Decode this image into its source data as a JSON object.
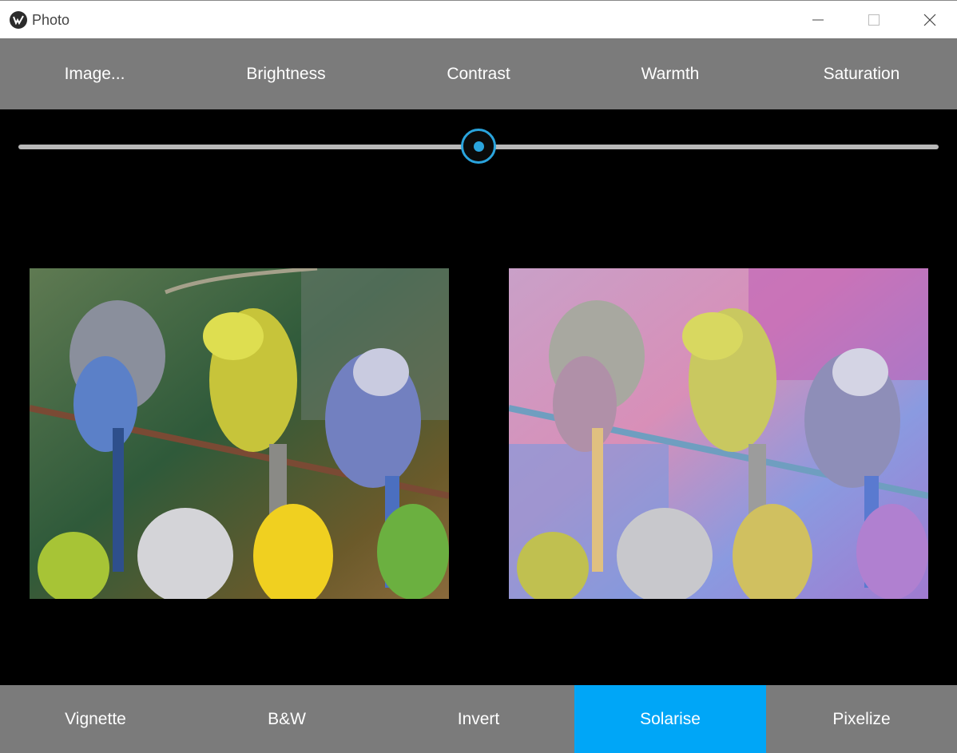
{
  "window": {
    "title": "Photo"
  },
  "toolbar_top": [
    "Image...",
    "Brightness",
    "Contrast",
    "Warmth",
    "Saturation"
  ],
  "slider": {
    "value_fraction": 0.5,
    "accent": "#2aa4dd"
  },
  "images": {
    "original": "original-image",
    "filtered": "solarised-image"
  },
  "toolbar_bottom": [
    "Vignette",
    "B&W",
    "Invert",
    "Solarise",
    "Pixelize"
  ],
  "active_filter": "Solarise",
  "colors": {
    "toolbar_bg": "#7b7b7b",
    "active_bg": "#00a6f7",
    "canvas_bg": "#000000"
  }
}
